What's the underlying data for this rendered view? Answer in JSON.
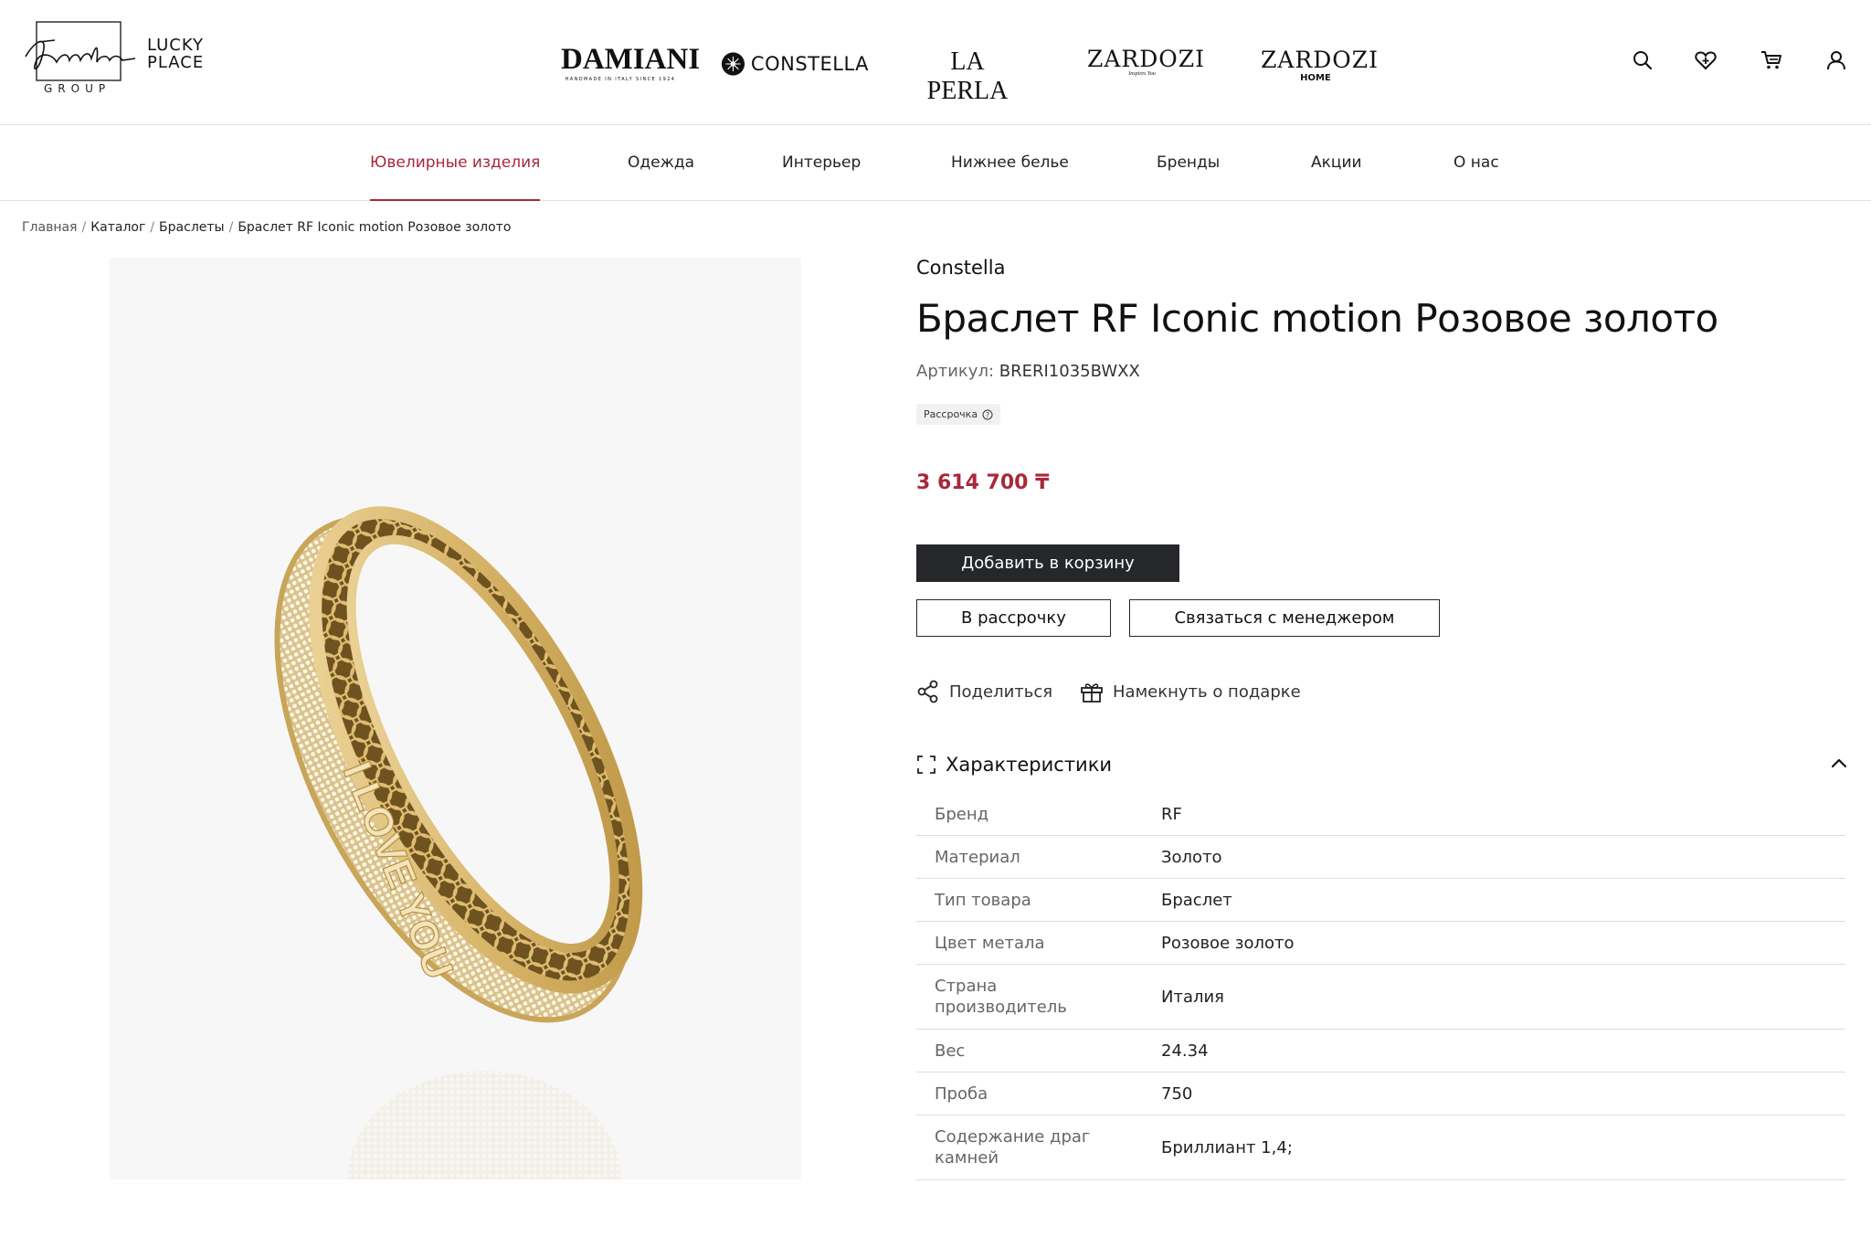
{
  "header": {
    "logo_signature": "Zhanna Kalm",
    "logo_group_word": "GROUP",
    "lucky_line1": "LUCKY",
    "lucky_line2": "PLACE",
    "brands": {
      "damiani": {
        "name": "DAMIANI",
        "tag": "HANDMADE IN ITALY SINCE 1924"
      },
      "constella": {
        "name": "CONSTELLA"
      },
      "laperla": {
        "name": "LA PERLA"
      },
      "zardozi": {
        "name": "ZARDOZI",
        "tag": "Inspires You"
      },
      "zardozi_home": {
        "name": "ZARDOZI",
        "tag": "HOME"
      }
    },
    "icons": [
      "search-icon",
      "favorites-icon",
      "cart-icon",
      "account-icon"
    ]
  },
  "nav": {
    "items": [
      {
        "label": "Ювелирные изделия",
        "active": true
      },
      {
        "label": "Одежда"
      },
      {
        "label": "Интерьер"
      },
      {
        "label": "Нижнее белье"
      },
      {
        "label": "Бренды"
      },
      {
        "label": "Акции"
      },
      {
        "label": "О нас"
      }
    ]
  },
  "breadcrumb": {
    "items": [
      "Главная",
      "Каталог",
      "Браслеты",
      "Браслет RF Iconic motion Розовое золото"
    ],
    "separator": "/"
  },
  "product": {
    "brand": "Constella",
    "title": "Браслет RF Iconic motion Розовое золото",
    "sku_label": "Артикул:",
    "sku_value": "BRERI1035BWXX",
    "installment_badge": "Рассрочка",
    "price": "3 614 700 ₸",
    "add_to_cart": "Добавить в корзину",
    "installment_button": "В рассрочку",
    "contact_manager": "Связаться с менеджером",
    "share": "Поделиться",
    "gift_hint": "Намекнуть о подарке",
    "image_alt": "I LOVE YOU"
  },
  "specs": {
    "title": "Характеристики",
    "rows": [
      {
        "key": "Бренд",
        "value": "RF"
      },
      {
        "key": "Материал",
        "value": "Золото"
      },
      {
        "key": "Тип товара",
        "value": "Браслет"
      },
      {
        "key": "Цвет метала",
        "value": "Розовое золото"
      },
      {
        "key": "Страна производитель",
        "value": "Италия"
      },
      {
        "key": "Вес",
        "value": "24.34"
      },
      {
        "key": "Проба",
        "value": "750"
      },
      {
        "key": "Содержание драг камней",
        "value": "Бриллиант 1,4;"
      }
    ]
  },
  "colors": {
    "accent": "#a8283c",
    "button_dark": "#25272a",
    "border": "#dddddd",
    "gold": "#c9a34e"
  }
}
